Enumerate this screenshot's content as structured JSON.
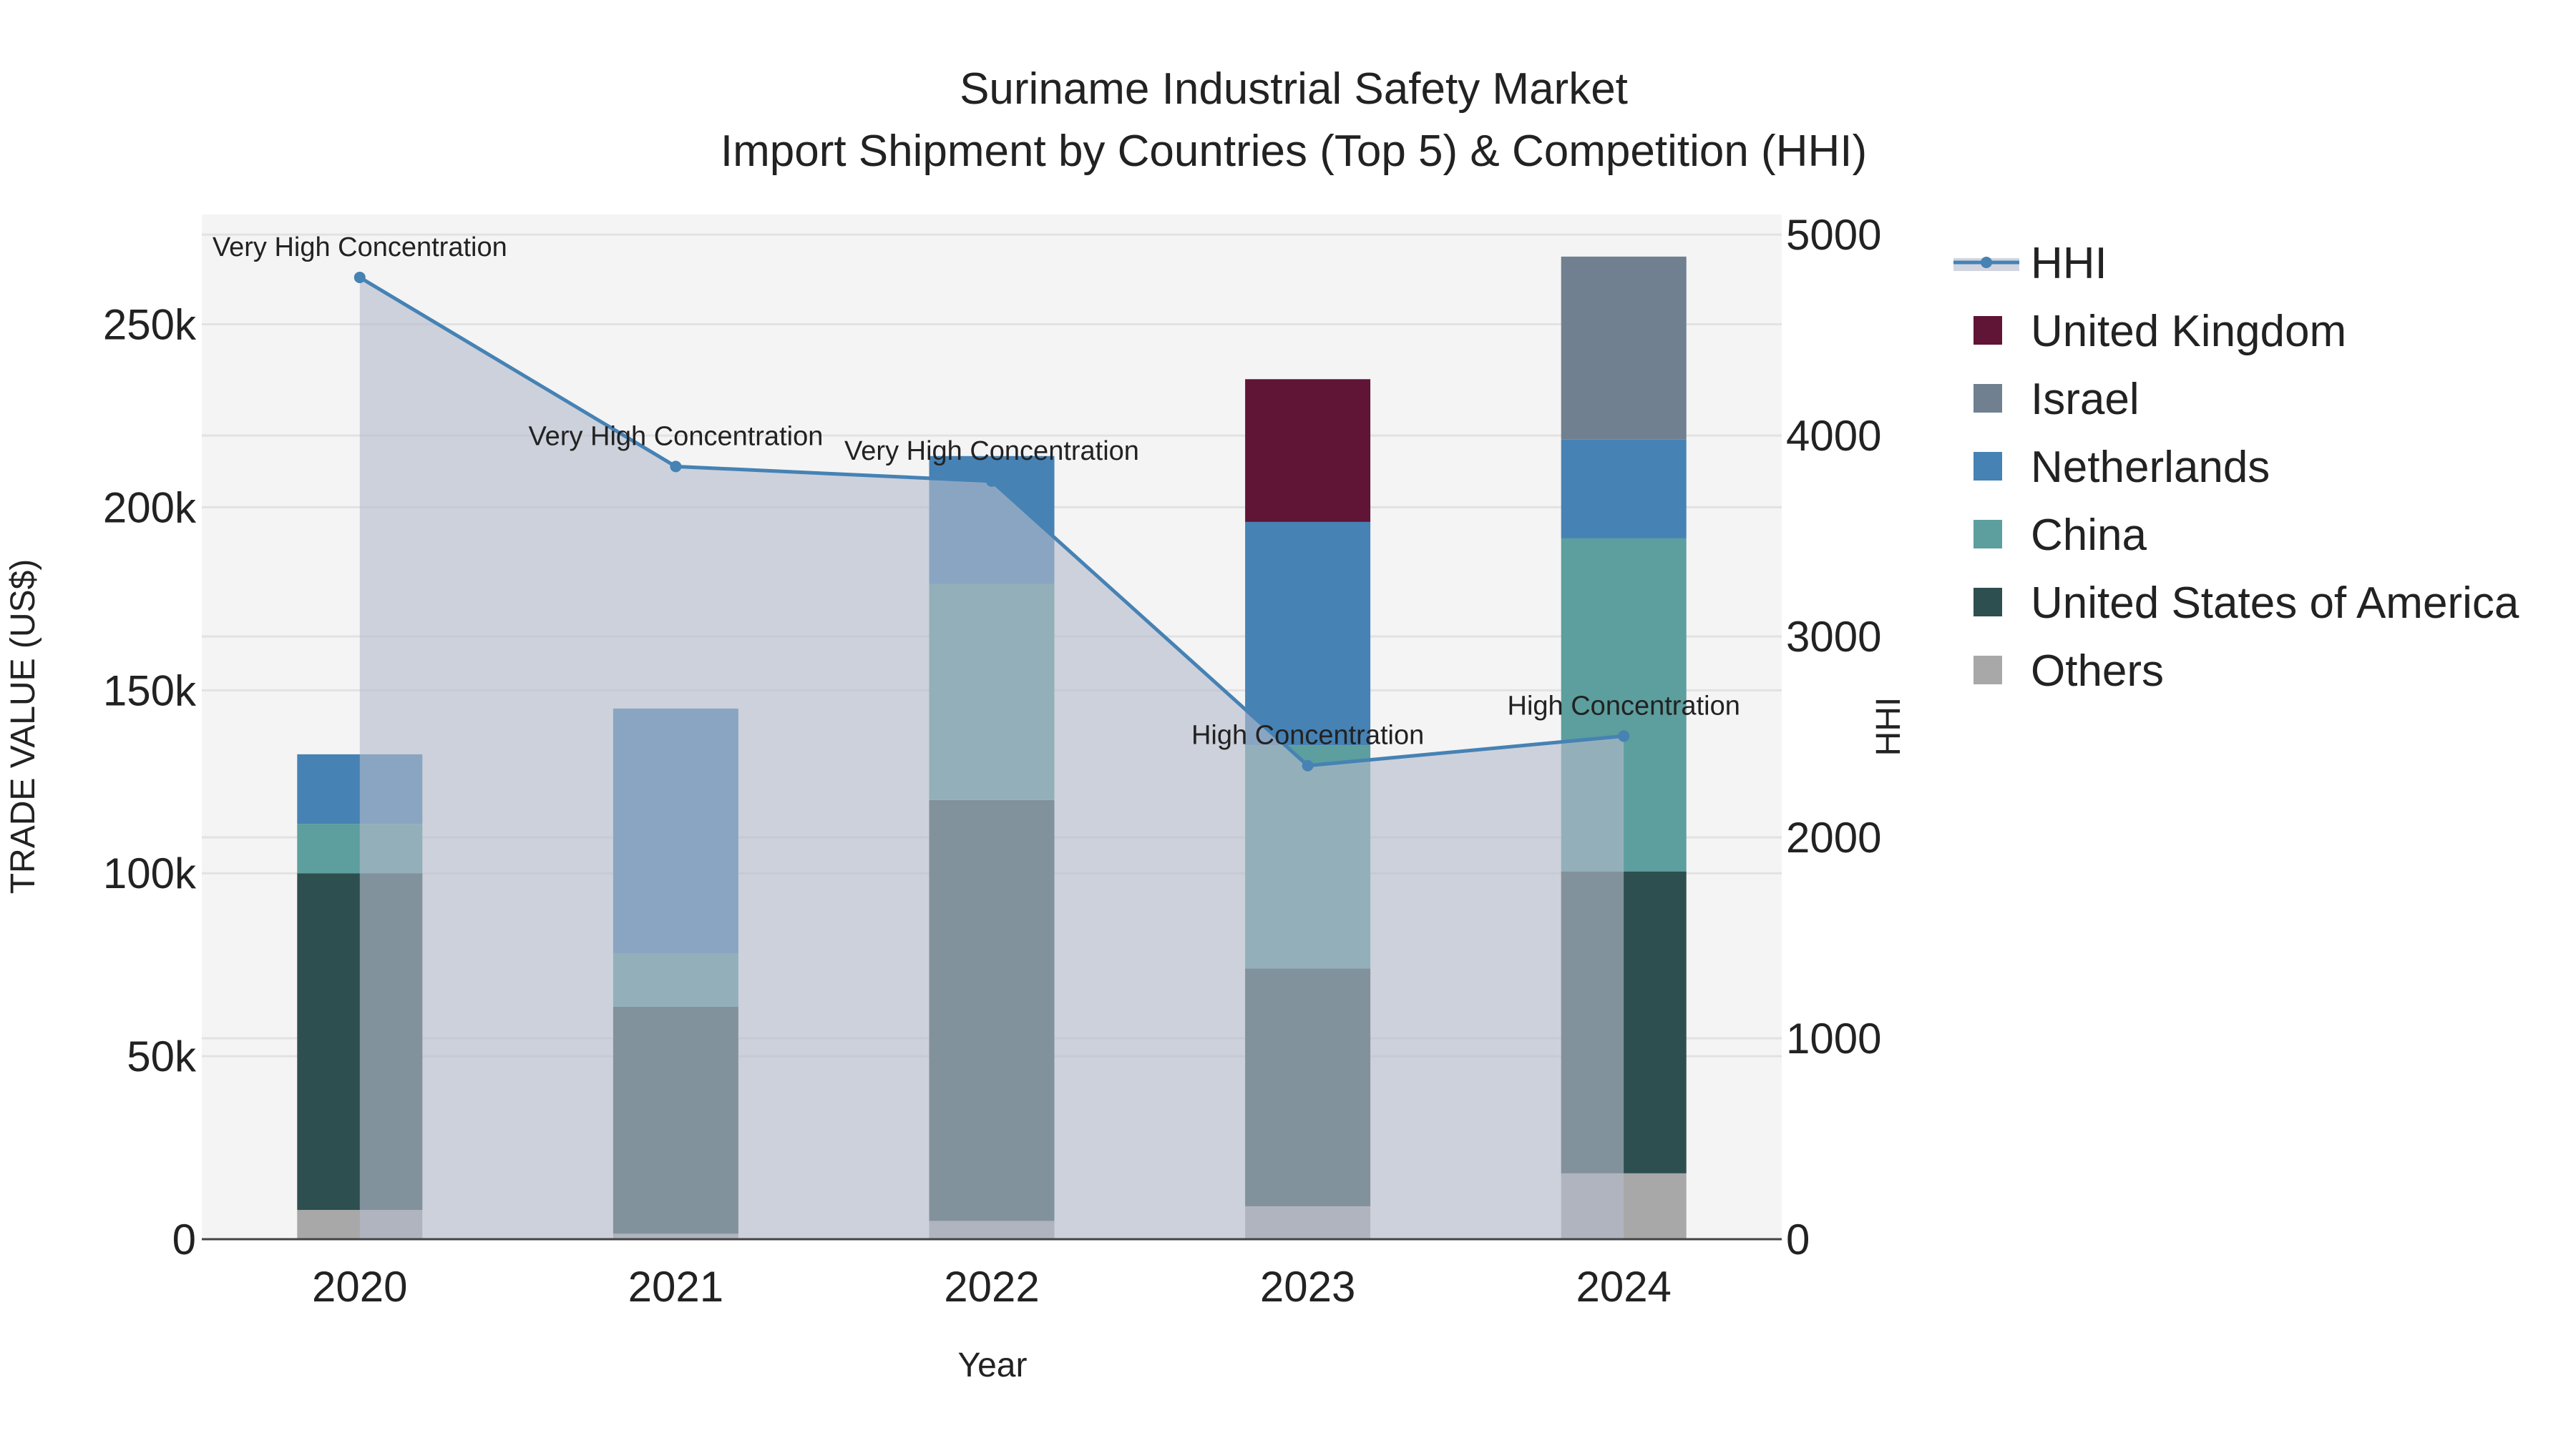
{
  "chart_data": {
    "type": "bar",
    "title": "Suriname Industrial Safety Market",
    "subtitle": "Import Shipment by Countries (Top 5) & Competition (HHI)",
    "xlabel": "Year",
    "ylabel": "TRADE VALUE (US$)",
    "y2label": "HHI",
    "categories": [
      "2020",
      "2021",
      "2022",
      "2023",
      "2024"
    ],
    "ylim": [
      0,
      280000
    ],
    "y2lim": [
      0,
      5100
    ],
    "yticks": [
      0,
      50000,
      100000,
      150000,
      200000,
      250000
    ],
    "ytick_labels": [
      "0",
      "50k",
      "100k",
      "150k",
      "200k",
      "250k"
    ],
    "y2ticks": [
      0,
      1000,
      2000,
      3000,
      4000,
      5000
    ],
    "y2tick_labels": [
      "0",
      "1000",
      "2000",
      "3000",
      "4000",
      "5000"
    ],
    "grid": true,
    "legend_position": "right",
    "series": [
      {
        "name": "Others",
        "color": "#a8a8a8",
        "values": [
          8000,
          1500,
          5000,
          9000,
          18000
        ]
      },
      {
        "name": "United States of America",
        "color": "#2e4f4f",
        "values": [
          92000,
          62000,
          115000,
          65000,
          82500
        ]
      },
      {
        "name": "China",
        "color": "#5d9e9e",
        "values": [
          13500,
          14500,
          59000,
          61000,
          91000
        ]
      },
      {
        "name": "Netherlands",
        "color": "#4682b4",
        "values": [
          19000,
          67000,
          35000,
          61000,
          27000
        ]
      },
      {
        "name": "Israel",
        "color": "#708090",
        "values": [
          0,
          0,
          0,
          0,
          50000
        ]
      },
      {
        "name": "United Kingdom",
        "color": "#601436",
        "values": [
          0,
          0,
          0,
          39000,
          0
        ]
      }
    ],
    "hhi": {
      "name": "HHI",
      "color": "#4682b4",
      "values": [
        4787,
        3846,
        3773,
        2357,
        2504
      ],
      "labels": [
        "Very High Concentration",
        "Very High Concentration",
        "Very High Concentration",
        "High Concentration",
        "High Concentration"
      ]
    },
    "legend_order": [
      "HHI",
      "United Kingdom",
      "Israel",
      "Netherlands",
      "China",
      "United States of America",
      "Others"
    ]
  }
}
